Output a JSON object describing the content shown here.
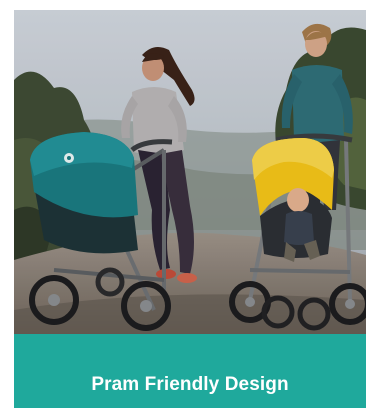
{
  "caption": {
    "text": "Pram Friendly Design",
    "bar_color": "#1fa99c",
    "text_color": "#ffffff"
  },
  "photo": {
    "subject": "photo-two-women-jogging-with-strollers",
    "left_stroller_canopy_color": "#1b7a80",
    "right_stroller_canopy_color": "#f2c318"
  }
}
